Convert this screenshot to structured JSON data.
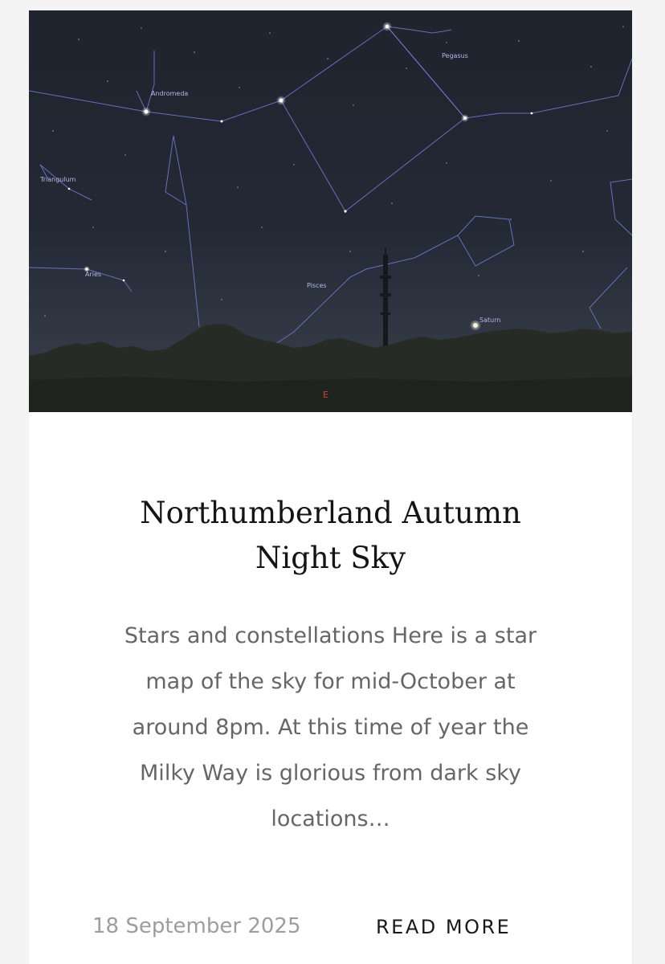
{
  "post": {
    "title_lines": [
      "Northumberland Autumn",
      "Night Sky"
    ],
    "excerpt_lines": [
      "Stars and constellations Here is a star",
      "map of the sky for mid-October at",
      "around 8pm. At this time of year the",
      "Milky Way is glorious from dark sky",
      "locations…"
    ],
    "date": "18 September 2025",
    "read_more_label": "READ MORE"
  },
  "sky_map": {
    "labels": {
      "pegasus": "Pegasus",
      "andromeda": "Andromeda",
      "triangulum": "Triangulum",
      "aries": "Aries",
      "pisces": "Pisces",
      "saturn": "Saturn",
      "east": "E"
    },
    "colors": {
      "sky_top": "#20242f",
      "sky_bottom": "#3a3f4c",
      "constellation_lines": "#6f7fd0",
      "ground": "#242822",
      "compass": "#d0402a"
    }
  },
  "icons": {
    "transmitter": "transmitter-mast-icon"
  }
}
